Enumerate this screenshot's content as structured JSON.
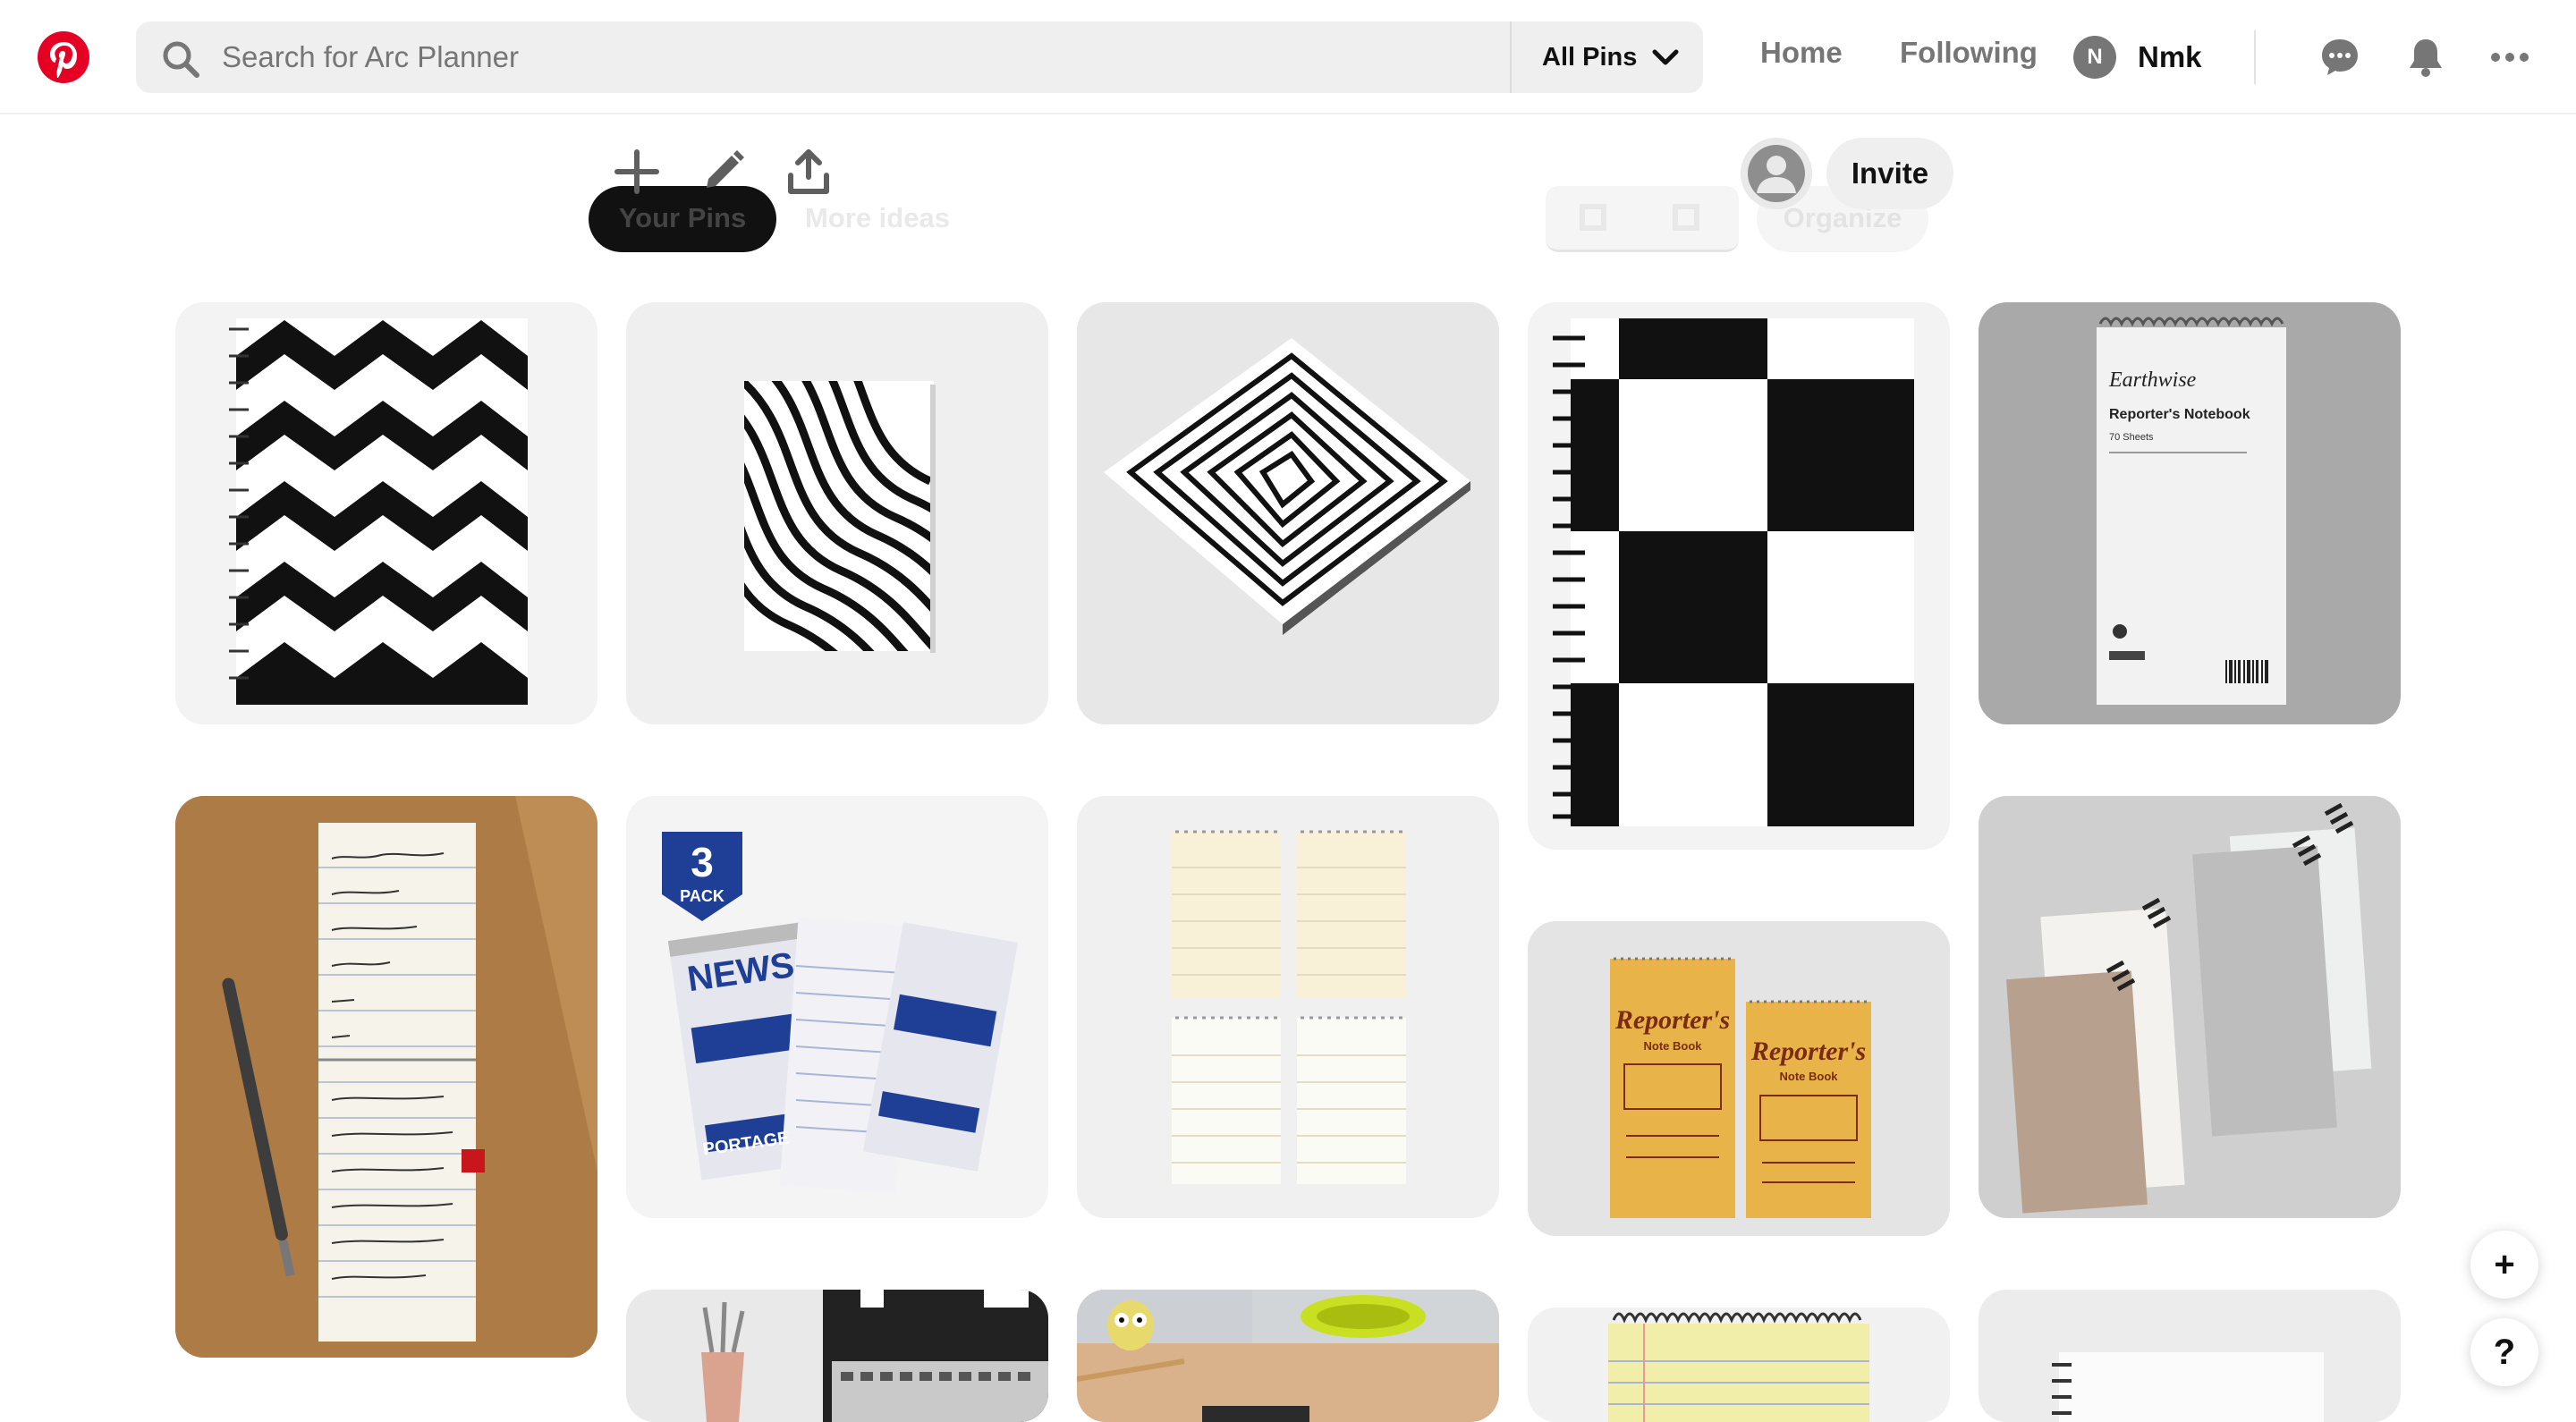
{
  "header": {
    "search_placeholder": "Search for Arc Planner",
    "filter_label": "All Pins",
    "nav_home": "Home",
    "nav_following": "Following",
    "profile_initial": "N",
    "profile_name": "Nmk"
  },
  "board": {
    "tab_your_pins": "Your Pins",
    "tab_more_ideas": "More ideas",
    "organize_label": "Organize",
    "invite_label": "Invite"
  },
  "pins": [
    {
      "name": "chevron-notebook"
    },
    {
      "name": "wavy-stripes-notebook"
    },
    {
      "name": "optical-squares-notebook"
    },
    {
      "name": "checkerboard-notebook"
    },
    {
      "name": "earthwise-reporters-notebook",
      "brand": "Earthwise",
      "title": "Reporter's Notebook",
      "subtitle": "70 Sheets"
    },
    {
      "name": "handwritten-reporters-pad"
    },
    {
      "name": "portage-news-notebooks",
      "badge_number": "3",
      "badge_text": "PACK",
      "cover_text": "NEWS",
      "brand": "PORTAGE"
    },
    {
      "name": "blank-notepads"
    },
    {
      "name": "kraft-reporters-note-books",
      "cover_text": "Reporter's",
      "cover_sub": "Note Book"
    },
    {
      "name": "spiral-notebooks-stack"
    },
    {
      "name": "desk-laptop-pencils"
    },
    {
      "name": "wooden-desk-items"
    },
    {
      "name": "yellow-legal-pad"
    },
    {
      "name": "white-spiral-pad"
    }
  ],
  "floating": {
    "add_symbol": "+",
    "help_symbol": "?"
  },
  "colors": {
    "brand_red": "#e60023",
    "search_bg": "#efefef",
    "muted_text": "#767676"
  },
  "icons": [
    "pinterest-logo-icon",
    "search-icon",
    "chevron-down-icon",
    "chat-icon",
    "bell-icon",
    "more-icon",
    "add-icon",
    "pencil-icon",
    "share-icon",
    "user-icon"
  ]
}
